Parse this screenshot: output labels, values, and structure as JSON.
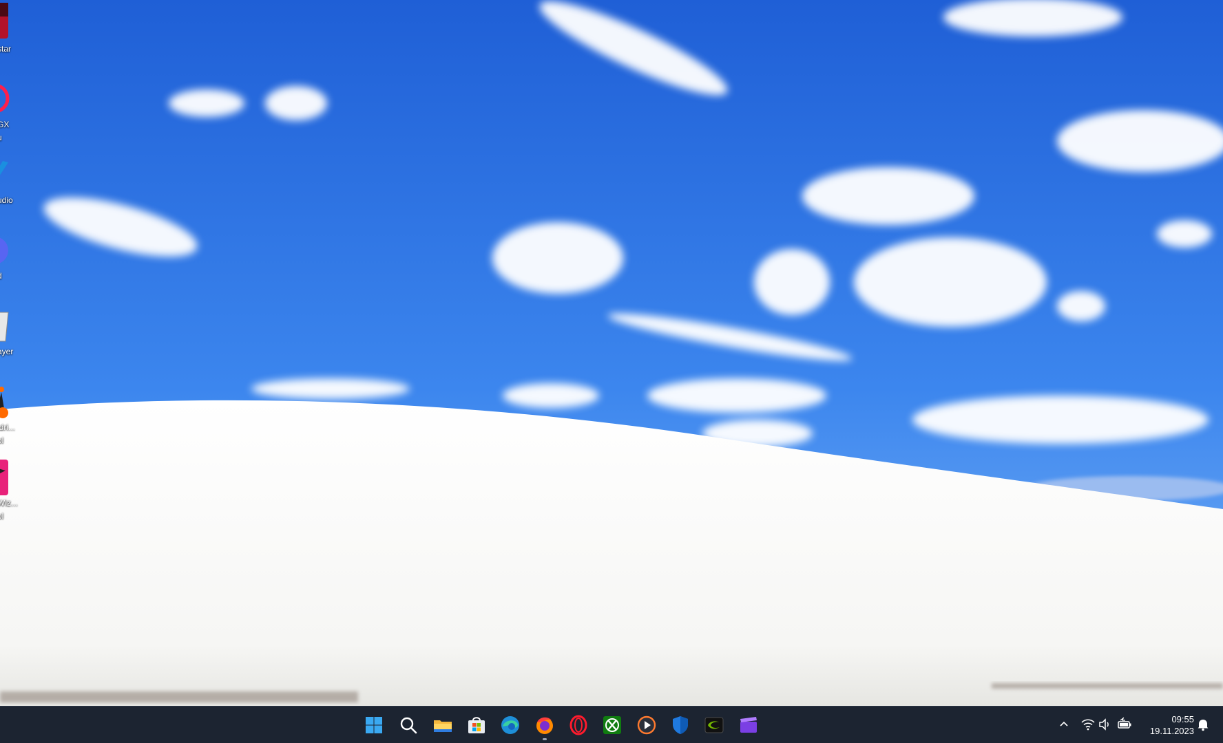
{
  "desktop": {
    "icons": [
      {
        "label": "star",
        "icon": "game-launcher-icon"
      },
      {
        "label": "GX\nu",
        "icon": "opera-gx-icon"
      },
      {
        "label": "udio",
        "icon": "audio-app-icon"
      },
      {
        "label": "d",
        "icon": "discord-icon"
      },
      {
        "label": "ayer",
        "icon": "media-player-icon"
      },
      {
        "label": "ldri...\nol",
        "icon": "driver-tool-icon"
      },
      {
        "label": "Wiz...\nol",
        "icon": "wizard-tool-icon"
      }
    ]
  },
  "taskbar": {
    "buttons": [
      {
        "icon": "windows-start-icon"
      },
      {
        "icon": "search-icon"
      },
      {
        "icon": "file-explorer-icon"
      },
      {
        "icon": "microsoft-store-icon"
      },
      {
        "icon": "edge-icon"
      },
      {
        "icon": "firefox-icon",
        "running": true
      },
      {
        "icon": "opera-icon"
      },
      {
        "icon": "xbox-icon"
      },
      {
        "icon": "media-player-icon"
      },
      {
        "icon": "windows-security-icon"
      },
      {
        "icon": "nvidia-icon"
      },
      {
        "icon": "clipchamp-icon"
      }
    ],
    "tray": {
      "icons": [
        "chevron-up-icon",
        "wifi-icon",
        "volume-icon",
        "battery-icon"
      ],
      "time": "09:55",
      "date": "19.11.2023",
      "notification_icon": "bell-icon"
    }
  },
  "colors": {
    "taskbar": "#1c2431",
    "sky": "#2a6bd9",
    "accent": "#0a84ff"
  }
}
